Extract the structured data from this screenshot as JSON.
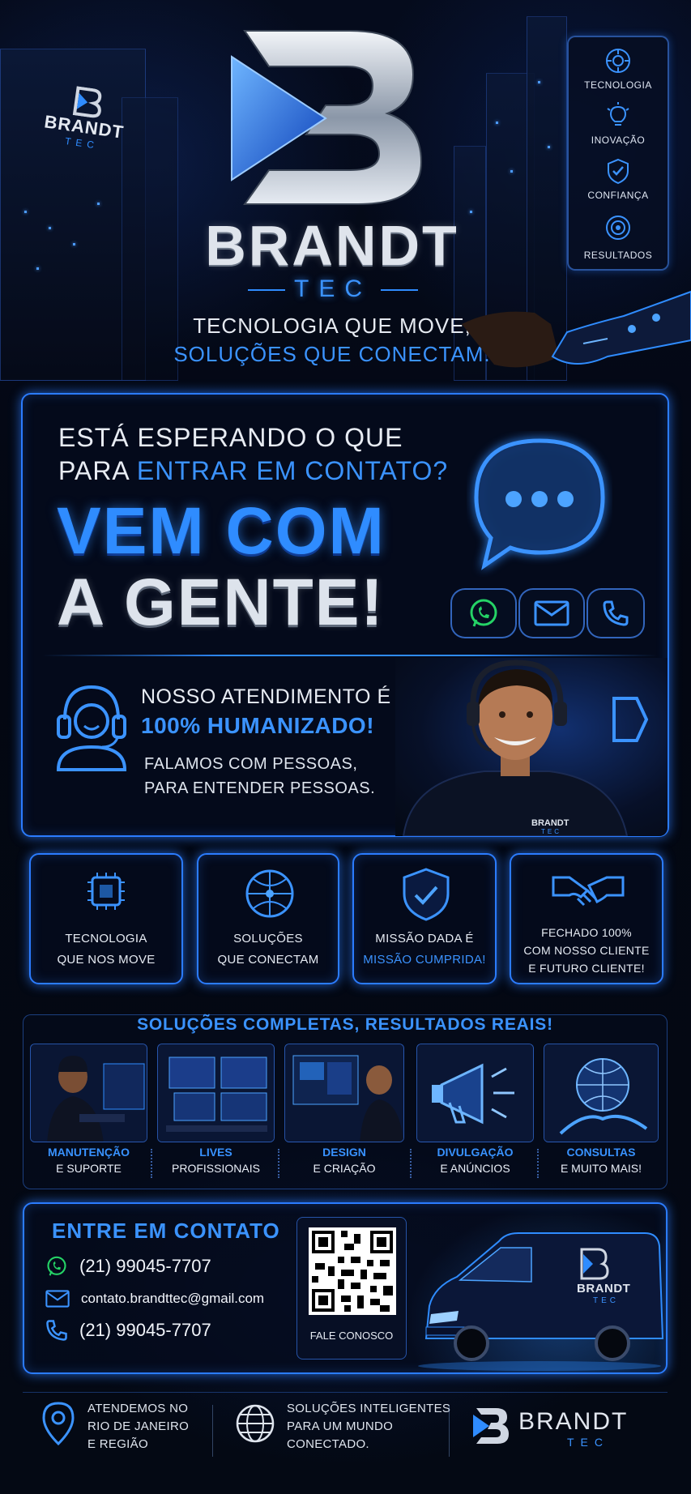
{
  "brand": {
    "name": "BRANDT",
    "sub": "TEC",
    "tagline_line1": "TECNOLOGIA QUE MOVE,",
    "tagline_line2": "SOLUÇÕES QUE CONECTAM.",
    "colors": {
      "accent": "#2f8cff",
      "background": "#03060f",
      "silver": "#d9dee6",
      "whatsapp": "#25d366"
    }
  },
  "side_panel": {
    "items": [
      {
        "label": "TECNOLOGIA",
        "icon": "gear-circuit-icon"
      },
      {
        "label": "INOVAÇÃO",
        "icon": "lightbulb-icon"
      },
      {
        "label": "CONFIANÇA",
        "icon": "shield-check-icon"
      },
      {
        "label": "RESULTADOS",
        "icon": "target-gear-icon"
      }
    ]
  },
  "hero": {
    "line1": "ESTÁ ESPERANDO O QUE",
    "line2_white": "PARA ",
    "line2_blue": "ENTRAR EM CONTATO?",
    "big1": "VEM COM",
    "big2": "A GENTE!"
  },
  "service_block": {
    "title_line1": "NOSSO ATENDIMENTO É",
    "title_line2": "100% HUMANIZADO!",
    "sub_line1": "FALAMOS COM PESSOAS,",
    "sub_line2": "PARA ENTENDER PESSOAS.",
    "shirt_brand": "BRANDT",
    "shirt_sub": "TEC"
  },
  "features": [
    {
      "line1": "TECNOLOGIA",
      "line2": "QUE NOS MOVE",
      "icon": "chip-icon"
    },
    {
      "line1": "SOLUÇÕES",
      "line2": "QUE CONECTAM",
      "icon": "network-globe-icon"
    },
    {
      "line1": "MISSÃO DADA É",
      "line2": "MISSÃO CUMPRIDA!",
      "icon": "shield-check-icon"
    },
    {
      "line1": "FECHADO 100%",
      "line2": "COM NOSSO CLIENTE",
      "line3": "E FUTURO CLIENTE!",
      "icon": "handshake-icon"
    }
  ],
  "solutions": {
    "title": "SOLUÇÕES COMPLETAS, RESULTADOS REAIS!",
    "items": [
      {
        "line1": "MANUTENÇÃO",
        "line2": "E SUPORTE"
      },
      {
        "line1": "LIVES",
        "line2": "PROFISSIONAIS"
      },
      {
        "line1": "DESIGN",
        "line2": "E CRIAÇÃO"
      },
      {
        "line1": "DIVULGAÇÃO",
        "line2": "E ANÚNCIOS"
      },
      {
        "line1": "CONSULTAS",
        "line2": "E MUITO MAIS!"
      }
    ]
  },
  "contact": {
    "title": "ENTRE EM CONTATO",
    "whatsapp": "(21) 99045-7707",
    "email": "contato.brandttec@gmail.com",
    "phone": "(21) 99045-7707",
    "qr_label": "FALE CONOSCO",
    "van_brand": "BRANDT",
    "van_sub": "TEC"
  },
  "footer": {
    "loc_line1": "ATENDEMOS NO",
    "loc_line2": "RIO DE JANEIRO",
    "loc_line3": "E REGIÃO",
    "web_line1": "SOLUÇÕES INTELIGENTES",
    "web_line2": "PARA UM MUNDO",
    "web_line3": "CONECTADO.",
    "brand": "BRANDT",
    "sub": "TEC"
  },
  "building_sign": {
    "brand": "BRANDT",
    "sub": "TEC"
  }
}
